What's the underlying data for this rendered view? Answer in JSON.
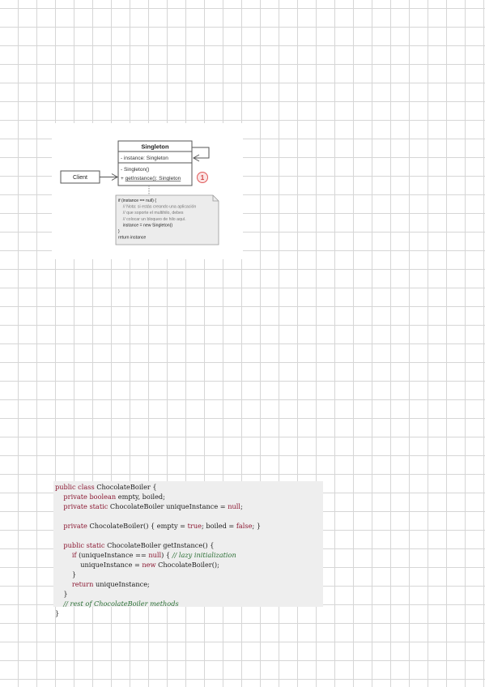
{
  "diagram": {
    "singleton_class": {
      "name": "Singleton",
      "field": "- instance: Singleton",
      "constructor": "- Singleton()",
      "method_prefix": "+ ",
      "method": "getInstance(): Singleton"
    },
    "client_label": "Client",
    "callout_number": "1",
    "note_lines": [
      "if (instance == null) {",
      "    // Nota: si estás creando una aplicación",
      "    // que soporte el multihilo, debes",
      "    // colocar un bloqueo de hilo aquí.",
      "    instance = new Singleton()",
      "}",
      "return instance"
    ],
    "colors": {
      "box_border": "#555555",
      "note_bg": "#ececec",
      "callout": "#e05a5a"
    }
  },
  "code": {
    "lines": [
      [
        {
          "t": "public class",
          "k": "kw"
        },
        {
          "t": " ChocolateBoiler {"
        }
      ],
      [
        {
          "t": "    "
        },
        {
          "t": "private boolean",
          "k": "kw"
        },
        {
          "t": " empty, boiled;"
        }
      ],
      [
        {
          "t": "    "
        },
        {
          "t": "private static",
          "k": "kw"
        },
        {
          "t": " ChocolateBoiler uniqueInstance = "
        },
        {
          "t": "null",
          "k": "kw"
        },
        {
          "t": ";"
        }
      ],
      [],
      [
        {
          "t": "    "
        },
        {
          "t": "private",
          "k": "kw"
        },
        {
          "t": " ChocolateBoiler() { empty = "
        },
        {
          "t": "true",
          "k": "kw"
        },
        {
          "t": "; boiled = "
        },
        {
          "t": "false",
          "k": "kw"
        },
        {
          "t": "; }"
        }
      ],
      [],
      [
        {
          "t": "    "
        },
        {
          "t": "public static",
          "k": "kw"
        },
        {
          "t": " ChocolateBoiler getInstance() {"
        }
      ],
      [
        {
          "t": "        "
        },
        {
          "t": "if",
          "k": "kw"
        },
        {
          "t": " (uniqueInstance == "
        },
        {
          "t": "null",
          "k": "kw"
        },
        {
          "t": ") { "
        },
        {
          "t": "// lazy initialization",
          "k": "cm"
        }
      ],
      [
        {
          "t": "            uniqueInstance = "
        },
        {
          "t": "new",
          "k": "kw"
        },
        {
          "t": " ChocolateBoiler();"
        }
      ],
      [
        {
          "t": "        }"
        }
      ],
      [
        {
          "t": "        "
        },
        {
          "t": "return",
          "k": "kw"
        },
        {
          "t": " uniqueInstance;"
        }
      ],
      [
        {
          "t": "    }"
        }
      ],
      [
        {
          "t": "    "
        },
        {
          "t": "// rest of ChocolateBoiler methods",
          "k": "cm"
        }
      ],
      [
        {
          "t": "}"
        }
      ]
    ]
  }
}
